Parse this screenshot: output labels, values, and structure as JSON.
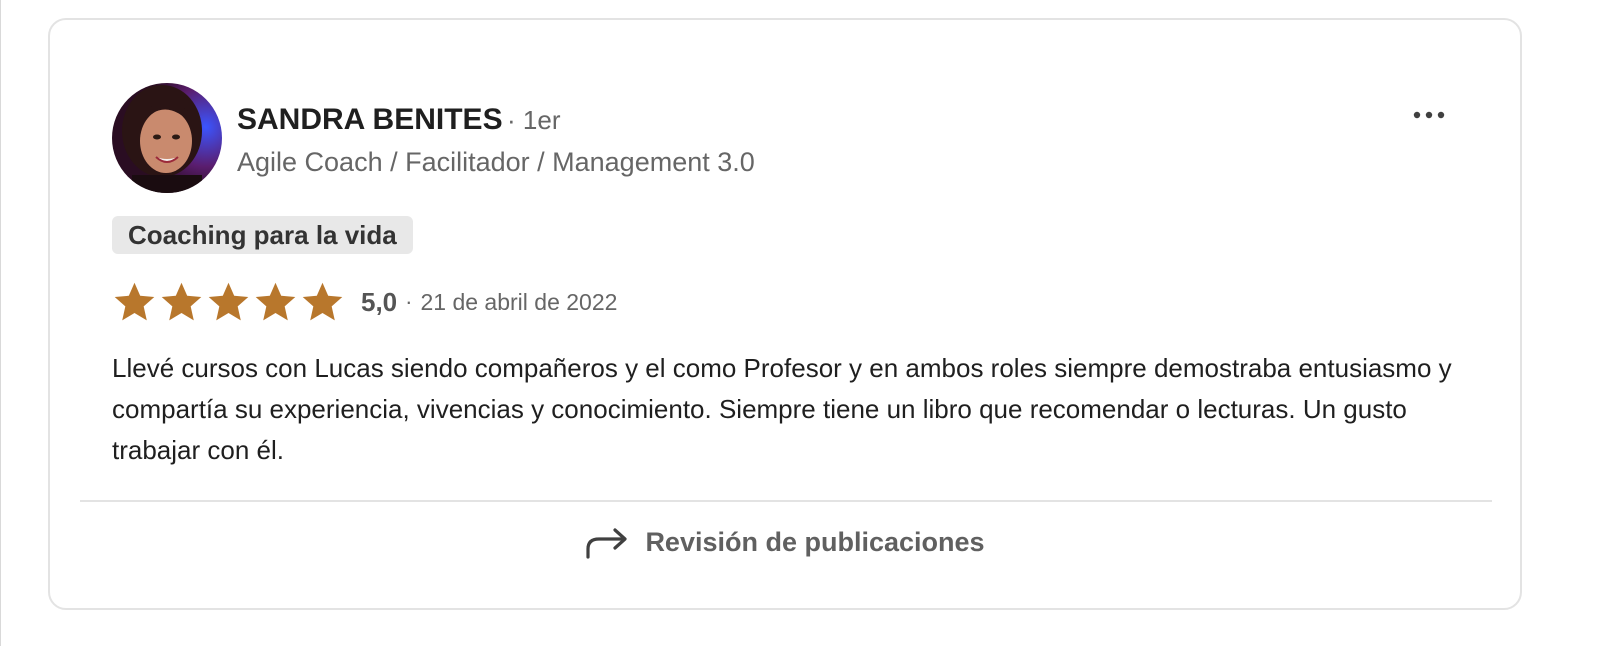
{
  "review": {
    "reviewer": {
      "name": "SANDRA BENITES",
      "degree": "· 1er",
      "headline": "Agile Coach / Facilitador / Management 3.0"
    },
    "service_tag": "Coaching para la vida",
    "rating": {
      "stars": 5,
      "value": "5,0",
      "separator": "·",
      "date": "21 de abril de 2022"
    },
    "text": "Llevé cursos con Lucas siendo compañeros y el como Profesor y en ambos roles siempre demostraba entusiasmo y compartía su experiencia, vivencias y conocimiento. Siempre tiene un libro que recomendar o lecturas. Un gusto trabajar con él.",
    "footer": {
      "link_label": "Revisión de publicaciones",
      "icon": "share-arrow-icon"
    },
    "menu_icon": "more-options-icon"
  },
  "colors": {
    "star": "#b8772c",
    "tag_background": "#e8e8e8",
    "border": "#e3e3e3",
    "text_primary": "#1f1f1f",
    "text_secondary": "#666666"
  }
}
